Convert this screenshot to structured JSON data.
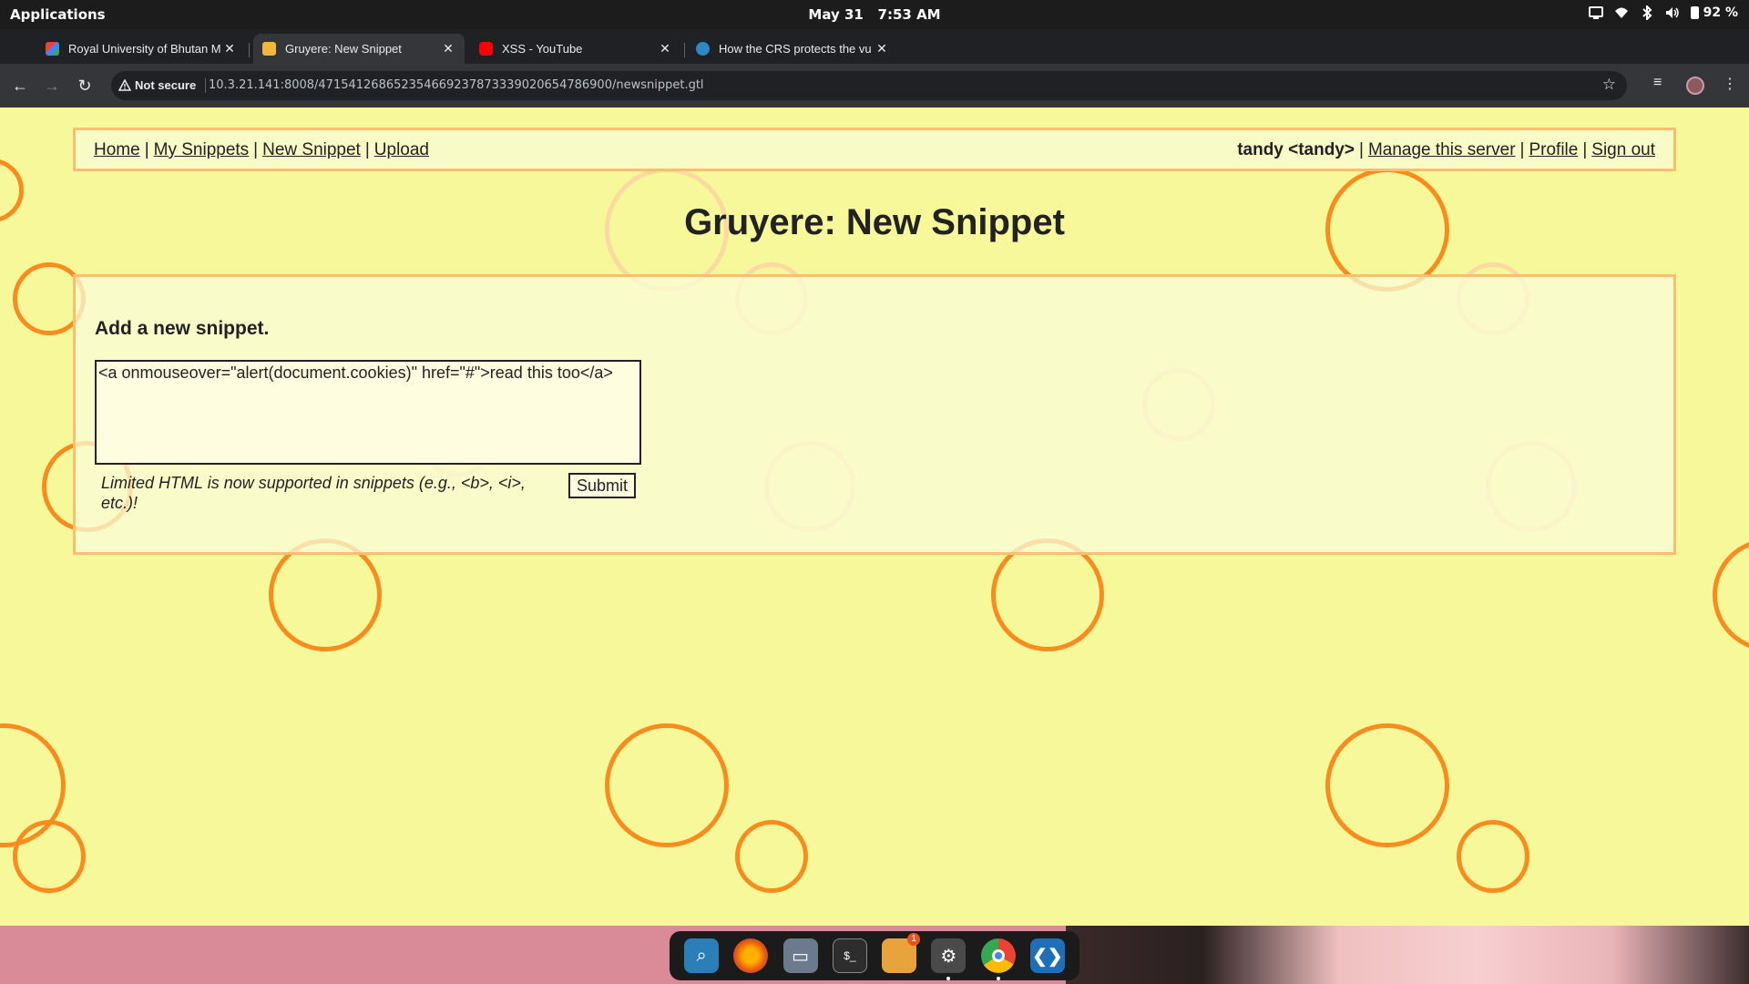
{
  "system_bar": {
    "applications_label": "Applications",
    "date": "May 31",
    "time": "7:53 AM",
    "battery": "92 %",
    "tray_icons": [
      "screen-icon",
      "wifi-icon",
      "bluetooth-icon",
      "volume-icon",
      "battery-icon"
    ]
  },
  "browser": {
    "tabs": [
      {
        "title": "Royal University of Bhutan M",
        "favicon": "gmail-icon",
        "active": false
      },
      {
        "title": "Gruyere: New Snippet",
        "favicon": "gruyere-icon",
        "active": true
      },
      {
        "title": "XSS - YouTube",
        "favicon": "youtube-icon",
        "active": false
      },
      {
        "title": "How the CRS protects the vu",
        "favicon": "crs-icon",
        "active": false
      }
    ],
    "security_label": "Not secure",
    "url": "10.3.21.141:8008/471541268652354669237873339020654786900/newsnippet.gtl",
    "new_tab_symbol": "+",
    "minimize_symbol": "–",
    "close_symbol": "×"
  },
  "page": {
    "nav": {
      "home": "Home",
      "my_snippets": "My Snippets",
      "new_snippet": "New Snippet",
      "upload": "Upload",
      "user": "tandy <tandy>",
      "manage": "Manage this server",
      "profile": "Profile",
      "sign_out": "Sign out",
      "separator": "|"
    },
    "title": "Gruyere: New Snippet",
    "heading": "Add a new snippet.",
    "snippet_value": "<a onmouseover=\"alert(document.cookies)\" href=\"#\">read this too</a>",
    "hint": "Limited HTML is now supported in snippets (e.g., <b>, <i>, etc.)!",
    "submit_label": "Submit"
  },
  "dock": {
    "apps": [
      "search-app-icon",
      "firefox-icon",
      "files-icon",
      "terminal-icon",
      "software-icon",
      "settings-icon",
      "chrome-icon",
      "vscode-icon"
    ],
    "badge_count": "1"
  },
  "colors": {
    "page_bg": "#f6f89a",
    "circle": "#fa8c1e",
    "box_border": "#fbbd6e"
  }
}
